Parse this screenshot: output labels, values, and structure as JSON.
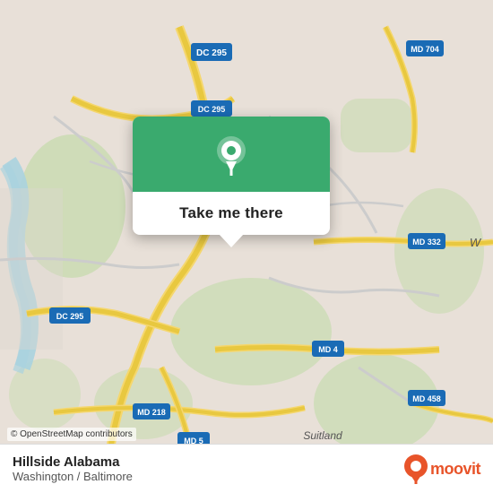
{
  "map": {
    "background_color": "#e8e0d8",
    "center_lat": 38.87,
    "center_lng": -76.92,
    "attribution": "© OpenStreetMap contributors"
  },
  "popup": {
    "button_label": "Take me there",
    "pin_icon": "location-pin"
  },
  "bottom_bar": {
    "location_name": "Hillside Alabama",
    "location_region": "Washington / Baltimore",
    "logo_text": "moovit"
  },
  "roads": {
    "dc295_label": "DC 295",
    "dc295_label2": "DC 295",
    "md4_label": "MD 4",
    "md218_label": "MD 218",
    "md5_label": "MD 5",
    "md332_label": "MD 332",
    "md704_label": "MD 704",
    "md458_label": "MD 458"
  }
}
